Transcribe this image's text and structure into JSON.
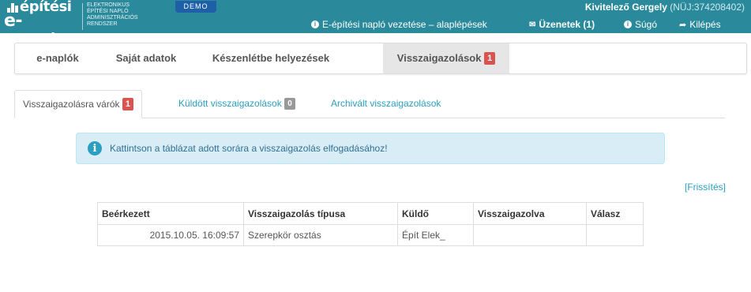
{
  "header": {
    "logo_top": "építési",
    "logo_bottom": "e-napló",
    "logo_sub": [
      "ELEKTRONIKUS",
      "ÉPÍTÉSI NAPLÓ",
      "ADMINISZTRÁCIÓS",
      "RENDSZER"
    ],
    "demo_badge": "DEMO",
    "user_name": "Kivitelező Gergely",
    "user_id": "(NÜJ:374208402)",
    "guide_link": "E-építési napló vezetése – alaplépések",
    "messages_link": "Üzenetek (1)",
    "help_link": "Súgó",
    "logout_link": "Kilépés"
  },
  "mainnav": {
    "items": [
      {
        "label": "e-naplók"
      },
      {
        "label": "Saját adatok"
      },
      {
        "label": "Készenlétbe helyezések"
      },
      {
        "label": "Visszaigazolások",
        "badge": "1"
      }
    ]
  },
  "subtabs": [
    {
      "label": "Visszaigazolásra várók",
      "badge": "1"
    },
    {
      "label": "Küldött visszaigazolások",
      "badge": "0"
    },
    {
      "label": "Archivált visszaigazolások"
    }
  ],
  "alert": {
    "text": "Kattintson a táblázat adott sorára a visszaigazolás elfogadásához!"
  },
  "refresh_link": "[Frissítés]",
  "table": {
    "headers": [
      "Beérkezett",
      "Visszaigazolás típusa",
      "Küldő",
      "Visszaigazolva",
      "Válasz"
    ],
    "rows": [
      [
        "2015.10.05. 16:09:57",
        "Szerepkör osztás",
        "Épít Elek_",
        "",
        ""
      ]
    ]
  },
  "colors": {
    "header_bg": "#2a8a9c",
    "badge_red": "#d9534f",
    "link": "#2a9fc0"
  }
}
